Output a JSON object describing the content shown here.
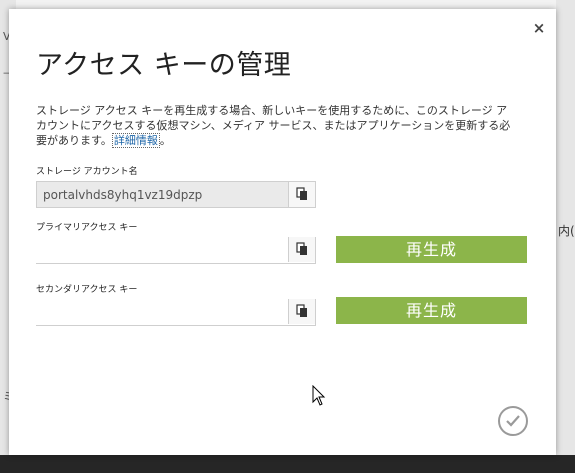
{
  "dialog": {
    "title": "アクセス キーの管理",
    "close_label": "×",
    "description": "ストレージ アクセス キーを再生成する場合、新しいキーを使用するために、このストレージ アカウントにアクセスする仮想マシン、メディア サービス、またはアプリケーションを更新する必要があります。",
    "more_info_link": "詳細情報",
    "more_info_suffix": "。",
    "storage_account": {
      "label": "ストレージ アカウント名",
      "value": "portalvhds8yhq1vz19dpzp"
    },
    "primary_key": {
      "label": "プライマリアクセス キー",
      "value": "",
      "regenerate_label": "再生成"
    },
    "secondary_key": {
      "label": "セカンダリアクセス キー",
      "value": "",
      "regenerate_label": "再生成"
    }
  },
  "background": {
    "right_edge_text": "内("
  },
  "colors": {
    "accent_green": "#8cb54a",
    "link_blue": "#1e66a8"
  },
  "icons": {
    "copy": "copy-icon",
    "close": "close-icon",
    "ok": "checkmark-icon",
    "cursor": "mouse-cursor-icon"
  }
}
